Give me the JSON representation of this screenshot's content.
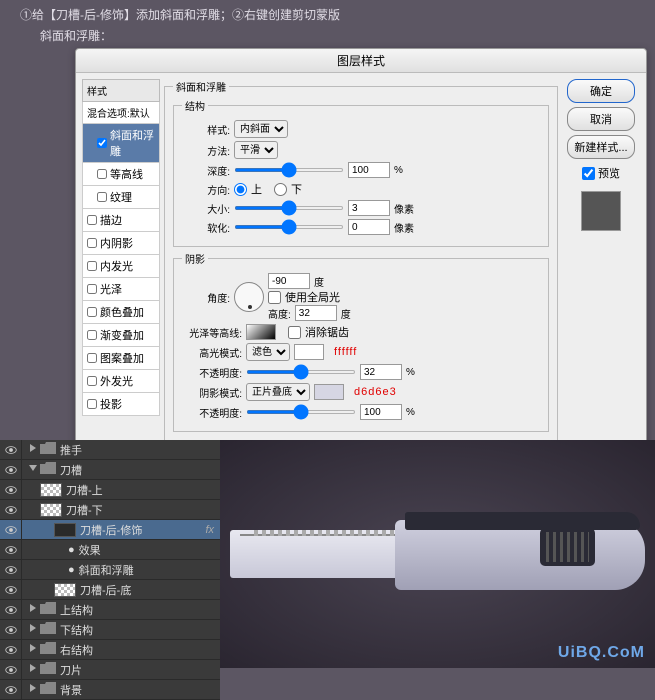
{
  "header": {
    "line1": "①给【刀槽-后-修饰】添加斜面和浮雕；②右键创建剪切蒙版",
    "line2_label": "斜面和浮雕："
  },
  "dialog": {
    "title": "图层样式",
    "styleListHeader": "样式",
    "styleBlend": "混合选项:默认",
    "styles": [
      "斜面和浮雕",
      "等高线",
      "纹理",
      "描边",
      "内阴影",
      "内发光",
      "光泽",
      "颜色叠加",
      "渐变叠加",
      "图案叠加",
      "外发光",
      "投影"
    ],
    "stylesChecked": [
      true,
      false,
      false,
      false,
      false,
      false,
      false,
      false,
      false,
      false,
      false,
      false
    ],
    "selectedIndex": 0,
    "bevel": {
      "groupTitle": "斜面和浮雕",
      "structTitle": "结构",
      "styleLabel": "样式:",
      "styleValue": "内斜面",
      "methodLabel": "方法:",
      "methodValue": "平滑",
      "depthLabel": "深度:",
      "depthValue": "100",
      "depthUnit": "%",
      "dirLabel": "方向:",
      "dirUp": "上",
      "dirDown": "下",
      "sizeLabel": "大小:",
      "sizeValue": "3",
      "sizeUnit": "像素",
      "softenLabel": "软化:",
      "softenValue": "0",
      "softenUnit": "像素"
    },
    "shade": {
      "groupTitle": "阴影",
      "angleLabel": "角度:",
      "angleValue": "-90",
      "angleUnit": "度",
      "globalLabel": "使用全局光",
      "altLabel": "高度:",
      "altValue": "32",
      "altUnit": "度",
      "glossLabel": "光泽等高线:",
      "antiLabel": "消除锯齿",
      "hiLabel": "高光模式:",
      "hiValue": "滤色",
      "hiHex": "ffffff",
      "hiOpLabel": "不透明度:",
      "hiOpValue": "32",
      "hiOpUnit": "%",
      "shLabel": "阴影模式:",
      "shValue": "正片叠底",
      "shHex": "d6d6e3",
      "shOpLabel": "不透明度:",
      "shOpValue": "100",
      "shOpUnit": "%"
    },
    "buttons": {
      "ok": "确定",
      "cancel": "取消",
      "newStyle": "新建样式...",
      "preview": "预览"
    }
  },
  "layers": {
    "items": [
      {
        "type": "group",
        "name": "推手",
        "i": 0
      },
      {
        "type": "group",
        "name": "刀槽",
        "i": 0,
        "open": true
      },
      {
        "type": "layer",
        "name": "刀槽-上",
        "i": 1,
        "checker": true
      },
      {
        "type": "layer",
        "name": "刀槽-下",
        "i": 1,
        "checker": true
      },
      {
        "type": "layer",
        "name": "刀槽-后-修饰",
        "i": 2,
        "dark": true,
        "sel": true,
        "fx": "fx"
      },
      {
        "type": "fx",
        "name": "效果",
        "i": 3
      },
      {
        "type": "fx",
        "name": "斜面和浮雕",
        "i": 3
      },
      {
        "type": "layer",
        "name": "刀槽-后-底",
        "i": 2,
        "checker": true
      },
      {
        "type": "group",
        "name": "上结构",
        "i": 0
      },
      {
        "type": "group",
        "name": "下结构",
        "i": 0
      },
      {
        "type": "group",
        "name": "右结构",
        "i": 0
      },
      {
        "type": "group",
        "name": "刀片",
        "i": 0
      },
      {
        "type": "group",
        "name": "背景",
        "i": 0
      }
    ]
  },
  "watermark": "UiBQ.CoM"
}
